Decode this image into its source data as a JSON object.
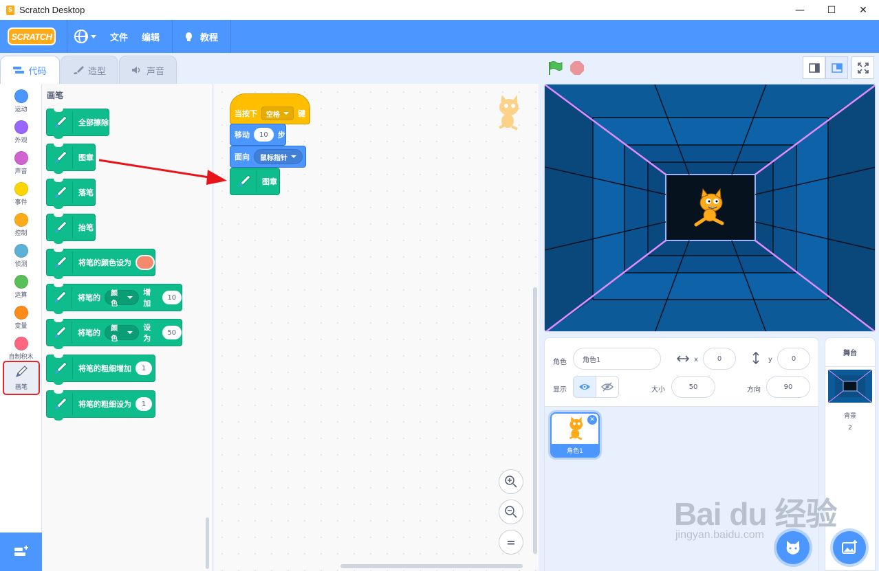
{
  "window": {
    "title": "Scratch Desktop"
  },
  "menubar": {
    "logo": "SCRATCH",
    "file": "文件",
    "edit": "编辑",
    "tutorials": "教程"
  },
  "tabs": [
    {
      "label": "代码"
    },
    {
      "label": "造型"
    },
    {
      "label": "声音"
    }
  ],
  "categories": [
    {
      "label": "运动",
      "color": "#4c97ff"
    },
    {
      "label": "外观",
      "color": "#9966ff"
    },
    {
      "label": "声音",
      "color": "#cf63cf"
    },
    {
      "label": "事件",
      "color": "#ffd500"
    },
    {
      "label": "控制",
      "color": "#ffab19"
    },
    {
      "label": "侦测",
      "color": "#5cb1d6"
    },
    {
      "label": "运算",
      "color": "#59c059"
    },
    {
      "label": "变量",
      "color": "#ff8c1a"
    },
    {
      "label": "自制积木",
      "color": "#ff6680"
    },
    {
      "label": "画笔",
      "color": "#0fbd8c"
    }
  ],
  "palette": {
    "title": "画笔",
    "blocks": {
      "clear": "全部擦除",
      "stamp": "图章",
      "pen_down": "落笔",
      "pen_up": "抬笔",
      "set_color": "将笔的颜色设为",
      "change_param_prefix": "将笔的",
      "change_param_drop": "颜色",
      "change_param_suffix": "增加",
      "change_param_value": "10",
      "set_param_prefix": "将笔的",
      "set_param_drop": "颜色",
      "set_param_suffix": "设为",
      "set_param_value": "50",
      "change_size": "将笔的粗细增加",
      "change_size_value": "1",
      "set_size": "将笔的粗细设为",
      "set_size_value": "1"
    }
  },
  "script": {
    "hat_prefix": "当按下",
    "hat_key": "空格",
    "hat_suffix": "键",
    "move_label": "移动",
    "move_value": "10",
    "move_suffix": "步",
    "point_label": "面向",
    "point_target": "鼠标指针",
    "stamp_label": "图章"
  },
  "zoom": {
    "reset": "="
  },
  "sprite_info": {
    "sprite_label": "角色",
    "sprite_name": "角色1",
    "x_label": "x",
    "x_value": "0",
    "y_label": "y",
    "y_value": "0",
    "show_label": "显示",
    "size_label": "大小",
    "size_value": "50",
    "direction_label": "方向",
    "direction_value": "90"
  },
  "sprites": [
    {
      "name": "角色1"
    }
  ],
  "stage_panel": {
    "title": "舞台",
    "backdrop_label": "背景",
    "backdrop_count": "2"
  },
  "watermark": {
    "text": "Bai du 经验",
    "url": "jingyan.baidu.com"
  }
}
